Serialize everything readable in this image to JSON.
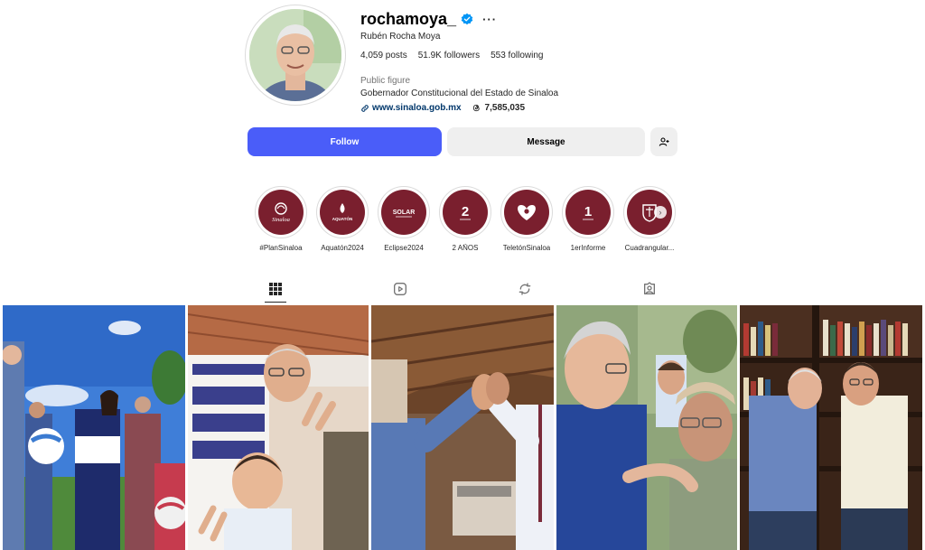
{
  "profile": {
    "username": "rochamoya_",
    "full_name": "Rubén Rocha Moya",
    "stats": {
      "posts": "4,059 posts",
      "followers": "51.9K followers",
      "following": "553 following"
    },
    "category": "Public figure",
    "bio": "Gobernador Constitucional del Estado de Sinaloa",
    "link": "www.sinaloa.gob.mx",
    "threads_count": "7,585,035"
  },
  "actions": {
    "follow_label": "Follow",
    "message_label": "Message"
  },
  "highlights": [
    {
      "label": "#PlanSinaloa",
      "icon_text": "Sinaloa"
    },
    {
      "label": "Aquatón2024",
      "icon_text": "AQUATÓN"
    },
    {
      "label": "Eclipse2024",
      "icon_text": "SOLAR"
    },
    {
      "label": "2 AÑOS",
      "icon_text": "2"
    },
    {
      "label": "TeletónSinaloa",
      "icon_text": ""
    },
    {
      "label": "1erInforme",
      "icon_text": "1"
    },
    {
      "label": "Cuadrangular...",
      "icon_text": ""
    }
  ],
  "tabs": [
    "posts-grid",
    "reels",
    "reposts",
    "tagged"
  ],
  "colors": {
    "follow_blue": "#4a5df9",
    "highlight_maroon": "#7a1f2e",
    "verified_blue": "#0095f6"
  }
}
